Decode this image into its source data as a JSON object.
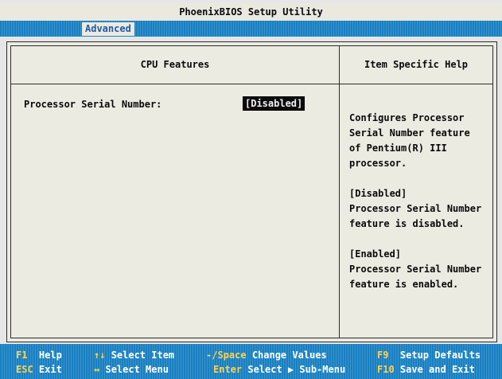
{
  "window": {
    "title": "PhoenixBIOS Setup Utility"
  },
  "menu": {
    "active_tab": "Advanced"
  },
  "panel": {
    "left_title": "CPU Features",
    "right_title": "Item Specific Help",
    "setting": {
      "label": "Processor Serial Number:",
      "value": "[Disabled]"
    },
    "help_text": "Configures Processor\nSerial Number feature\nof Pentium(R) III\nprocessor.\n\n[Disabled]\nProcessor Serial Number\nfeature is disabled.\n\n[Enabled]\nProcessor Serial Number\nfeature is enabled."
  },
  "footer": {
    "keys": [
      {
        "key": "F1",
        "desc": "Help"
      },
      {
        "key": "↑↓",
        "desc": "Select Item"
      },
      {
        "key": "-/Space",
        "desc": "Change Values"
      },
      {
        "key": "F9",
        "desc": "Setup Defaults"
      },
      {
        "key": "ESC",
        "desc": "Exit"
      },
      {
        "key": "↔",
        "desc": "Select Menu"
      },
      {
        "key": "Enter",
        "desc": "Select ▶ Sub-Menu"
      },
      {
        "key": "F10",
        "desc": "Save and Exit"
      }
    ]
  },
  "colors": {
    "menubar": "#1a7fc0",
    "panel_bg": "#ecebe2",
    "key_highlight": "#ffd24d",
    "selected_value_bg": "#0b0b0b"
  }
}
